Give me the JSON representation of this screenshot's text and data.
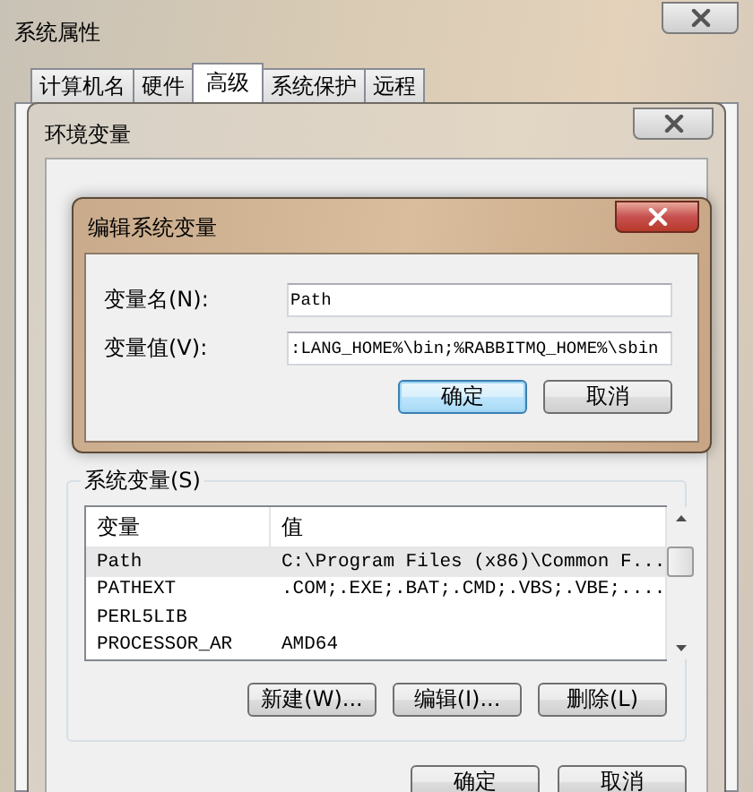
{
  "window": {
    "title": "系统属性"
  },
  "tabs": [
    {
      "label": "计算机名",
      "selected": false
    },
    {
      "label": "硬件",
      "selected": false
    },
    {
      "label": "高级",
      "selected": true
    },
    {
      "label": "系统保护",
      "selected": false
    },
    {
      "label": "远程",
      "selected": false
    }
  ],
  "env_window": {
    "title": "环境变量",
    "system_vars": {
      "label": "系统变量(S)",
      "columns": [
        "变量",
        "值"
      ],
      "rows": [
        {
          "name": "Path",
          "value": "C:\\Program Files (x86)\\Common F...",
          "selected": true
        },
        {
          "name": "PATHEXT",
          "value": ".COM;.EXE;.BAT;.CMD;.VBS;.VBE;....",
          "selected": false
        },
        {
          "name": "PERL5LIB",
          "value": "",
          "selected": false
        },
        {
          "name": "PROCESSOR_AR",
          "value": "AMD64",
          "selected": false
        }
      ],
      "buttons": [
        {
          "label": "新建(W)..."
        },
        {
          "label": "编辑(I)..."
        },
        {
          "label": "删除(L)"
        }
      ]
    },
    "buttons": [
      {
        "label": "确定"
      },
      {
        "label": "取消"
      }
    ]
  },
  "edit_dialog": {
    "title": "编辑系统变量",
    "fields": [
      {
        "label": "变量名(N):",
        "value": "Path"
      },
      {
        "label": "变量值(V):",
        "value": ":LANG_HOME%\\bin;%RABBITMQ_HOME%\\sbin"
      }
    ],
    "buttons": [
      {
        "label": "确定",
        "default": true
      },
      {
        "label": "取消",
        "default": false
      }
    ]
  }
}
